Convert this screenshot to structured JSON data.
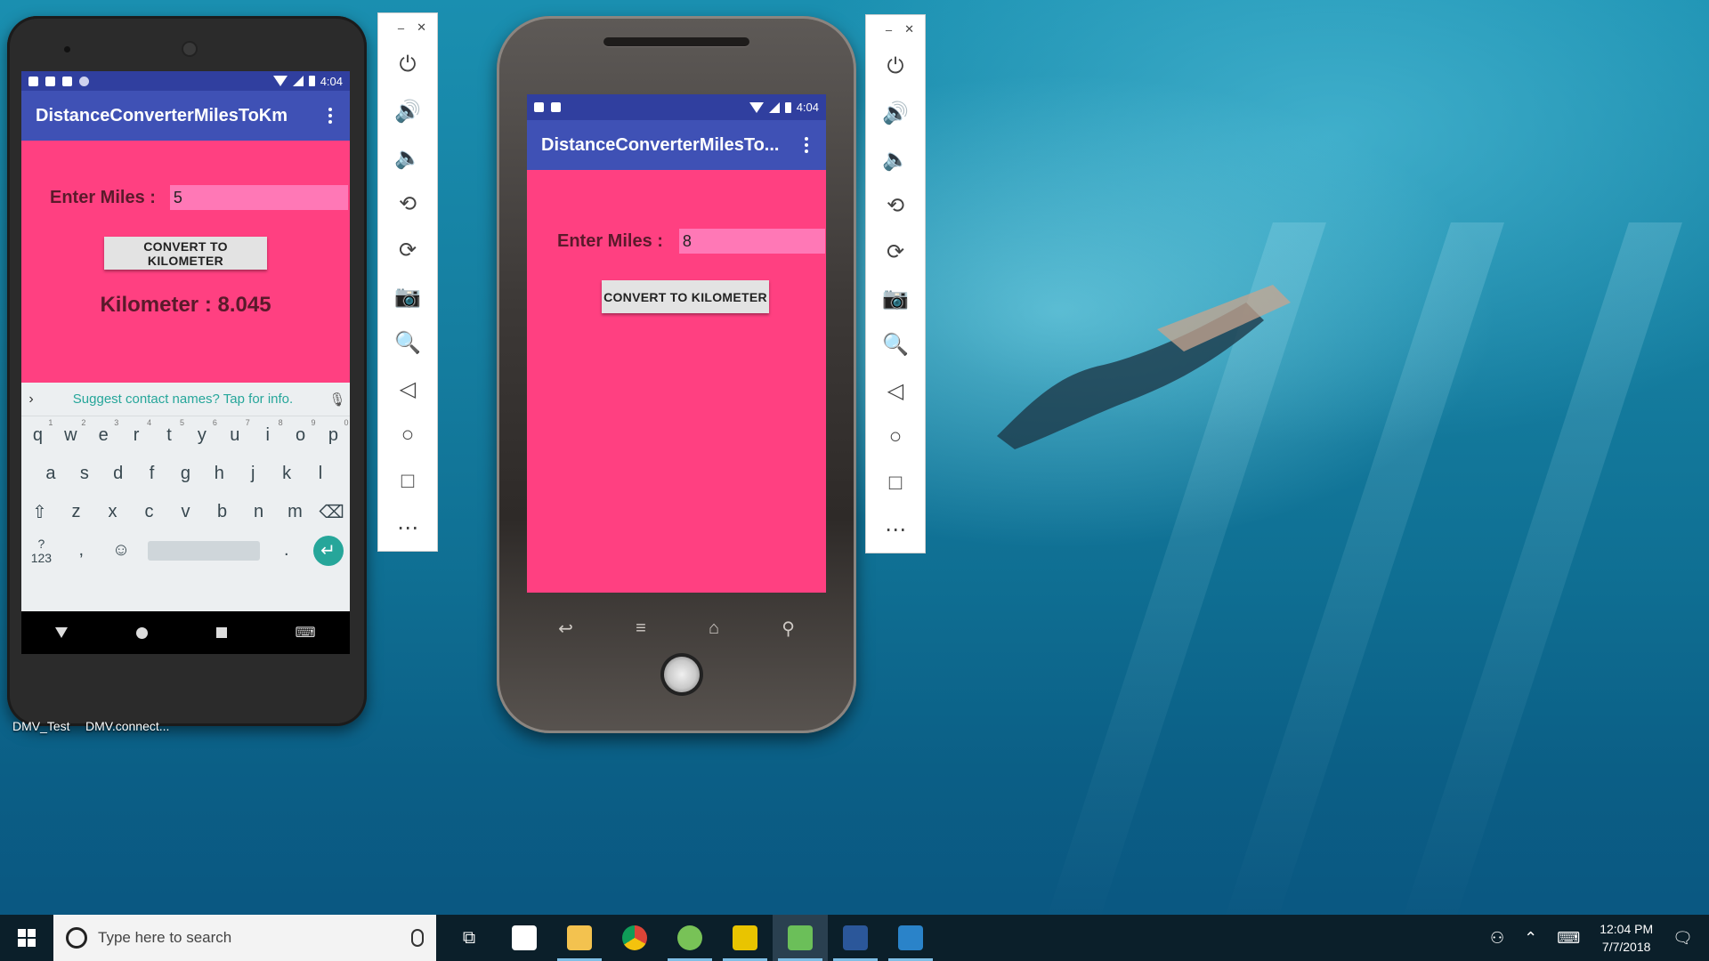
{
  "emulator_left": {
    "status_time": "4:04",
    "app_title": "DistanceConverterMilesToKm",
    "enter_miles_label": "Enter Miles :",
    "miles_value": "5",
    "convert_button": "CONVERT TO KILOMETER",
    "result_text": "Kilometer : 8.045",
    "keyboard": {
      "suggestion": "Suggest contact names? Tap for info.",
      "row1": [
        "q",
        "w",
        "e",
        "r",
        "t",
        "y",
        "u",
        "i",
        "o",
        "p"
      ],
      "row1_hints": [
        "1",
        "2",
        "3",
        "4",
        "5",
        "6",
        "7",
        "8",
        "9",
        "0"
      ],
      "row2": [
        "a",
        "s",
        "d",
        "f",
        "g",
        "h",
        "j",
        "k",
        "l"
      ],
      "row3": [
        "z",
        "x",
        "c",
        "v",
        "b",
        "n",
        "m"
      ],
      "symbols_key": "?123",
      "comma_key": ",",
      "period_key": "."
    }
  },
  "emulator_right": {
    "status_time": "4:04",
    "app_title": "DistanceConverterMilesTo...",
    "enter_miles_label": "Enter Miles :",
    "miles_value": "8",
    "convert_button": "CONVERT TO KILOMETER"
  },
  "toolbar_buttons": [
    "power-icon",
    "volume-up-icon",
    "volume-down-icon",
    "rotate-left-icon",
    "rotate-right-icon",
    "camera-icon",
    "zoom-icon",
    "back-icon",
    "home-icon",
    "overview-icon",
    "more-icon"
  ],
  "desktop_labels": [
    "DMV_Test",
    "DMV.connect..."
  ],
  "taskbar": {
    "search_placeholder": "Type here to search",
    "time": "12:04 PM",
    "date": "7/7/2018"
  },
  "colors": {
    "app_background": "#ff4081",
    "app_bar": "#3f51b5",
    "status_bar": "#303f9f",
    "input_background": "#ff78b6",
    "enter_key": "#26a69a"
  }
}
